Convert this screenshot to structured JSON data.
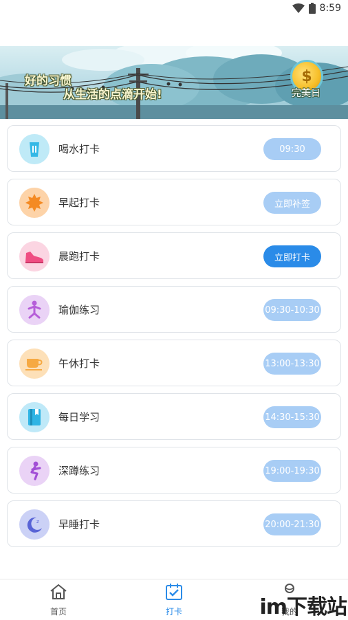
{
  "status": {
    "time": "8:59"
  },
  "banner": {
    "slogan_line1": "好的习惯",
    "slogan_line2": "从生活的点滴开始!",
    "perfect_day_label": "完美日",
    "coin_symbol": "$"
  },
  "tasks": [
    {
      "label": "喝水打卡",
      "action": "09:30",
      "icon": "water-cup-icon",
      "icon_bg": "#bfeaf7",
      "icon_color": "#33b8e6",
      "state": "pending"
    },
    {
      "label": "早起打卡",
      "action": "立即补签",
      "icon": "sun-icon",
      "icon_bg": "#fdd3a8",
      "icon_color": "#f48a23",
      "state": "pending"
    },
    {
      "label": "晨跑打卡",
      "action": "立即打卡",
      "icon": "running-shoe-icon",
      "icon_bg": "#fbd5e2",
      "icon_color": "#ef4d82",
      "state": "active"
    },
    {
      "label": "瑜伽练习",
      "action": "09:30-10:30",
      "icon": "yoga-icon",
      "icon_bg": "#ead3f6",
      "icon_color": "#b65ed9",
      "state": "pending"
    },
    {
      "label": "午休打卡",
      "action": "13:00-13:30",
      "icon": "coffee-cup-icon",
      "icon_bg": "#fde0b8",
      "icon_color": "#f6a942",
      "state": "pending"
    },
    {
      "label": "每日学习",
      "action": "14:30-15:30",
      "icon": "book-icon",
      "icon_bg": "#bfe9f8",
      "icon_color": "#2fb4e4",
      "state": "pending"
    },
    {
      "label": "深蹲练习",
      "action": "19:00-19:30",
      "icon": "squat-icon",
      "icon_bg": "#ead3f6",
      "icon_color": "#a24fd6",
      "state": "pending"
    },
    {
      "label": "早睡打卡",
      "action": "20:00-21:30",
      "icon": "moon-icon",
      "icon_bg": "#cbd1f6",
      "icon_color": "#5863d6",
      "state": "pending"
    }
  ],
  "tabbar": {
    "home_label": "首页",
    "checkin_label": "打卡",
    "mine_label": "我的",
    "active_color": "#2a8be8"
  },
  "watermark": {
    "text": "im下载站"
  },
  "colors": {
    "pill_pending": "#a8cdf5",
    "pill_active": "#2a8be8"
  }
}
